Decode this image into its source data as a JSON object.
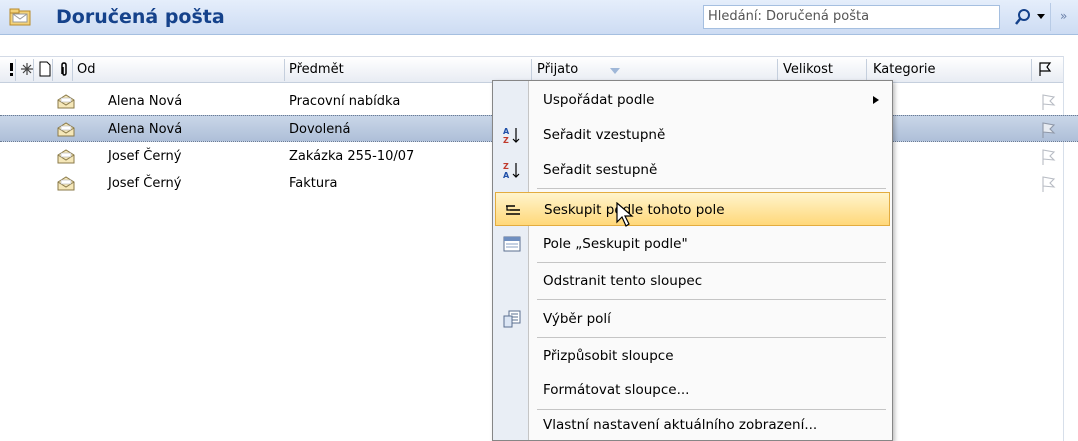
{
  "title": "Doručená pošta",
  "search": {
    "placeholder": "Hledání: Doručená pošta"
  },
  "columns": {
    "from": "Od",
    "subject": "Předmět",
    "received": "Přijato",
    "size": "Velikost",
    "category": "Kategorie"
  },
  "rows": [
    {
      "from": "Alena Nová",
      "subject": "Pracovní nabídka",
      "selected": false
    },
    {
      "from": "Alena Nová",
      "subject": "Dovolená",
      "selected": true
    },
    {
      "from": "Josef Černý",
      "subject": "Zakázka 255-10/07",
      "selected": false
    },
    {
      "from": "Josef Černý",
      "subject": "Faktura",
      "selected": false
    }
  ],
  "menu": {
    "items": [
      {
        "label": "Uspořádat podle",
        "icon": "none",
        "submenu": true
      },
      {
        "label": "Seřadit vzestupně",
        "icon": "sort-ascending-icon"
      },
      {
        "label": "Seřadit sestupně",
        "icon": "sort-descending-icon"
      },
      {
        "label": "Seskupit podle tohoto pole",
        "icon": "group-by-icon",
        "highlighted": true
      },
      {
        "label": "Pole „Seskupit podle\"",
        "icon": "group-by-box-icon"
      },
      {
        "label": "Odstranit tento sloupec",
        "icon": "none"
      },
      {
        "label": "Výběr polí",
        "icon": "field-chooser-icon"
      },
      {
        "label": "Přizpůsobit sloupce",
        "icon": "none"
      },
      {
        "label": "Formátovat sloupce...",
        "icon": "none"
      },
      {
        "label": "Vlastní nastavení aktuálního zobrazení...",
        "icon": "none"
      }
    ]
  },
  "colors": {
    "title": "#15428b",
    "selection": "#b8c8de",
    "menu_hover": "#ffe08a"
  }
}
